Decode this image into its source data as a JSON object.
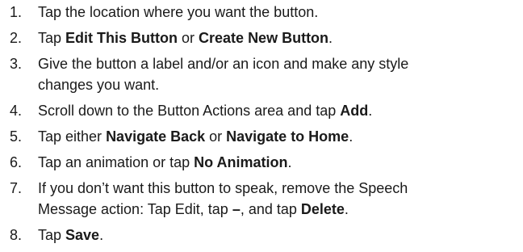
{
  "steps": [
    {
      "number": "1.",
      "parts": [
        {
          "text": "Tap the location where you want the button.",
          "bold": false
        }
      ]
    },
    {
      "number": "2.",
      "parts": [
        {
          "text": "Tap ",
          "bold": false
        },
        {
          "text": "Edit This Button",
          "bold": true
        },
        {
          "text": " or ",
          "bold": false
        },
        {
          "text": "Create New Button",
          "bold": true
        },
        {
          "text": ".",
          "bold": false
        }
      ]
    },
    {
      "number": "3.",
      "parts": [
        {
          "text": "Give the button a label and/or an icon and make any style",
          "bold": false
        },
        {
          "text": "changes you want.",
          "bold": false,
          "newline": true
        }
      ]
    },
    {
      "number": "4.",
      "parts": [
        {
          "text": "Scroll down to the Button Actions area and tap ",
          "bold": false
        },
        {
          "text": "Add",
          "bold": true
        },
        {
          "text": ".",
          "bold": false
        }
      ]
    },
    {
      "number": "5.",
      "parts": [
        {
          "text": "Tap either ",
          "bold": false
        },
        {
          "text": "Navigate Back",
          "bold": true
        },
        {
          "text": " or ",
          "bold": false
        },
        {
          "text": "Navigate to Home",
          "bold": true
        },
        {
          "text": ".",
          "bold": false
        }
      ]
    },
    {
      "number": "6.",
      "parts": [
        {
          "text": "Tap an animation or tap ",
          "bold": false
        },
        {
          "text": "No Animation",
          "bold": true
        },
        {
          "text": ".",
          "bold": false
        }
      ]
    },
    {
      "number": "7.",
      "parts": [
        {
          "text": "If you don’t want this button to speak, remove the Speech",
          "bold": false
        },
        {
          "text": "Message action: Tap Edit, tap ",
          "bold": false,
          "newline": true
        },
        {
          "text": "–",
          "bold": true
        },
        {
          "text": ", and tap ",
          "bold": false
        },
        {
          "text": "Delete",
          "bold": true
        },
        {
          "text": ".",
          "bold": false
        }
      ]
    },
    {
      "number": "8.",
      "parts": [
        {
          "text": "Tap ",
          "bold": false
        },
        {
          "text": "Save",
          "bold": true
        },
        {
          "text": ".",
          "bold": false
        }
      ]
    }
  ]
}
